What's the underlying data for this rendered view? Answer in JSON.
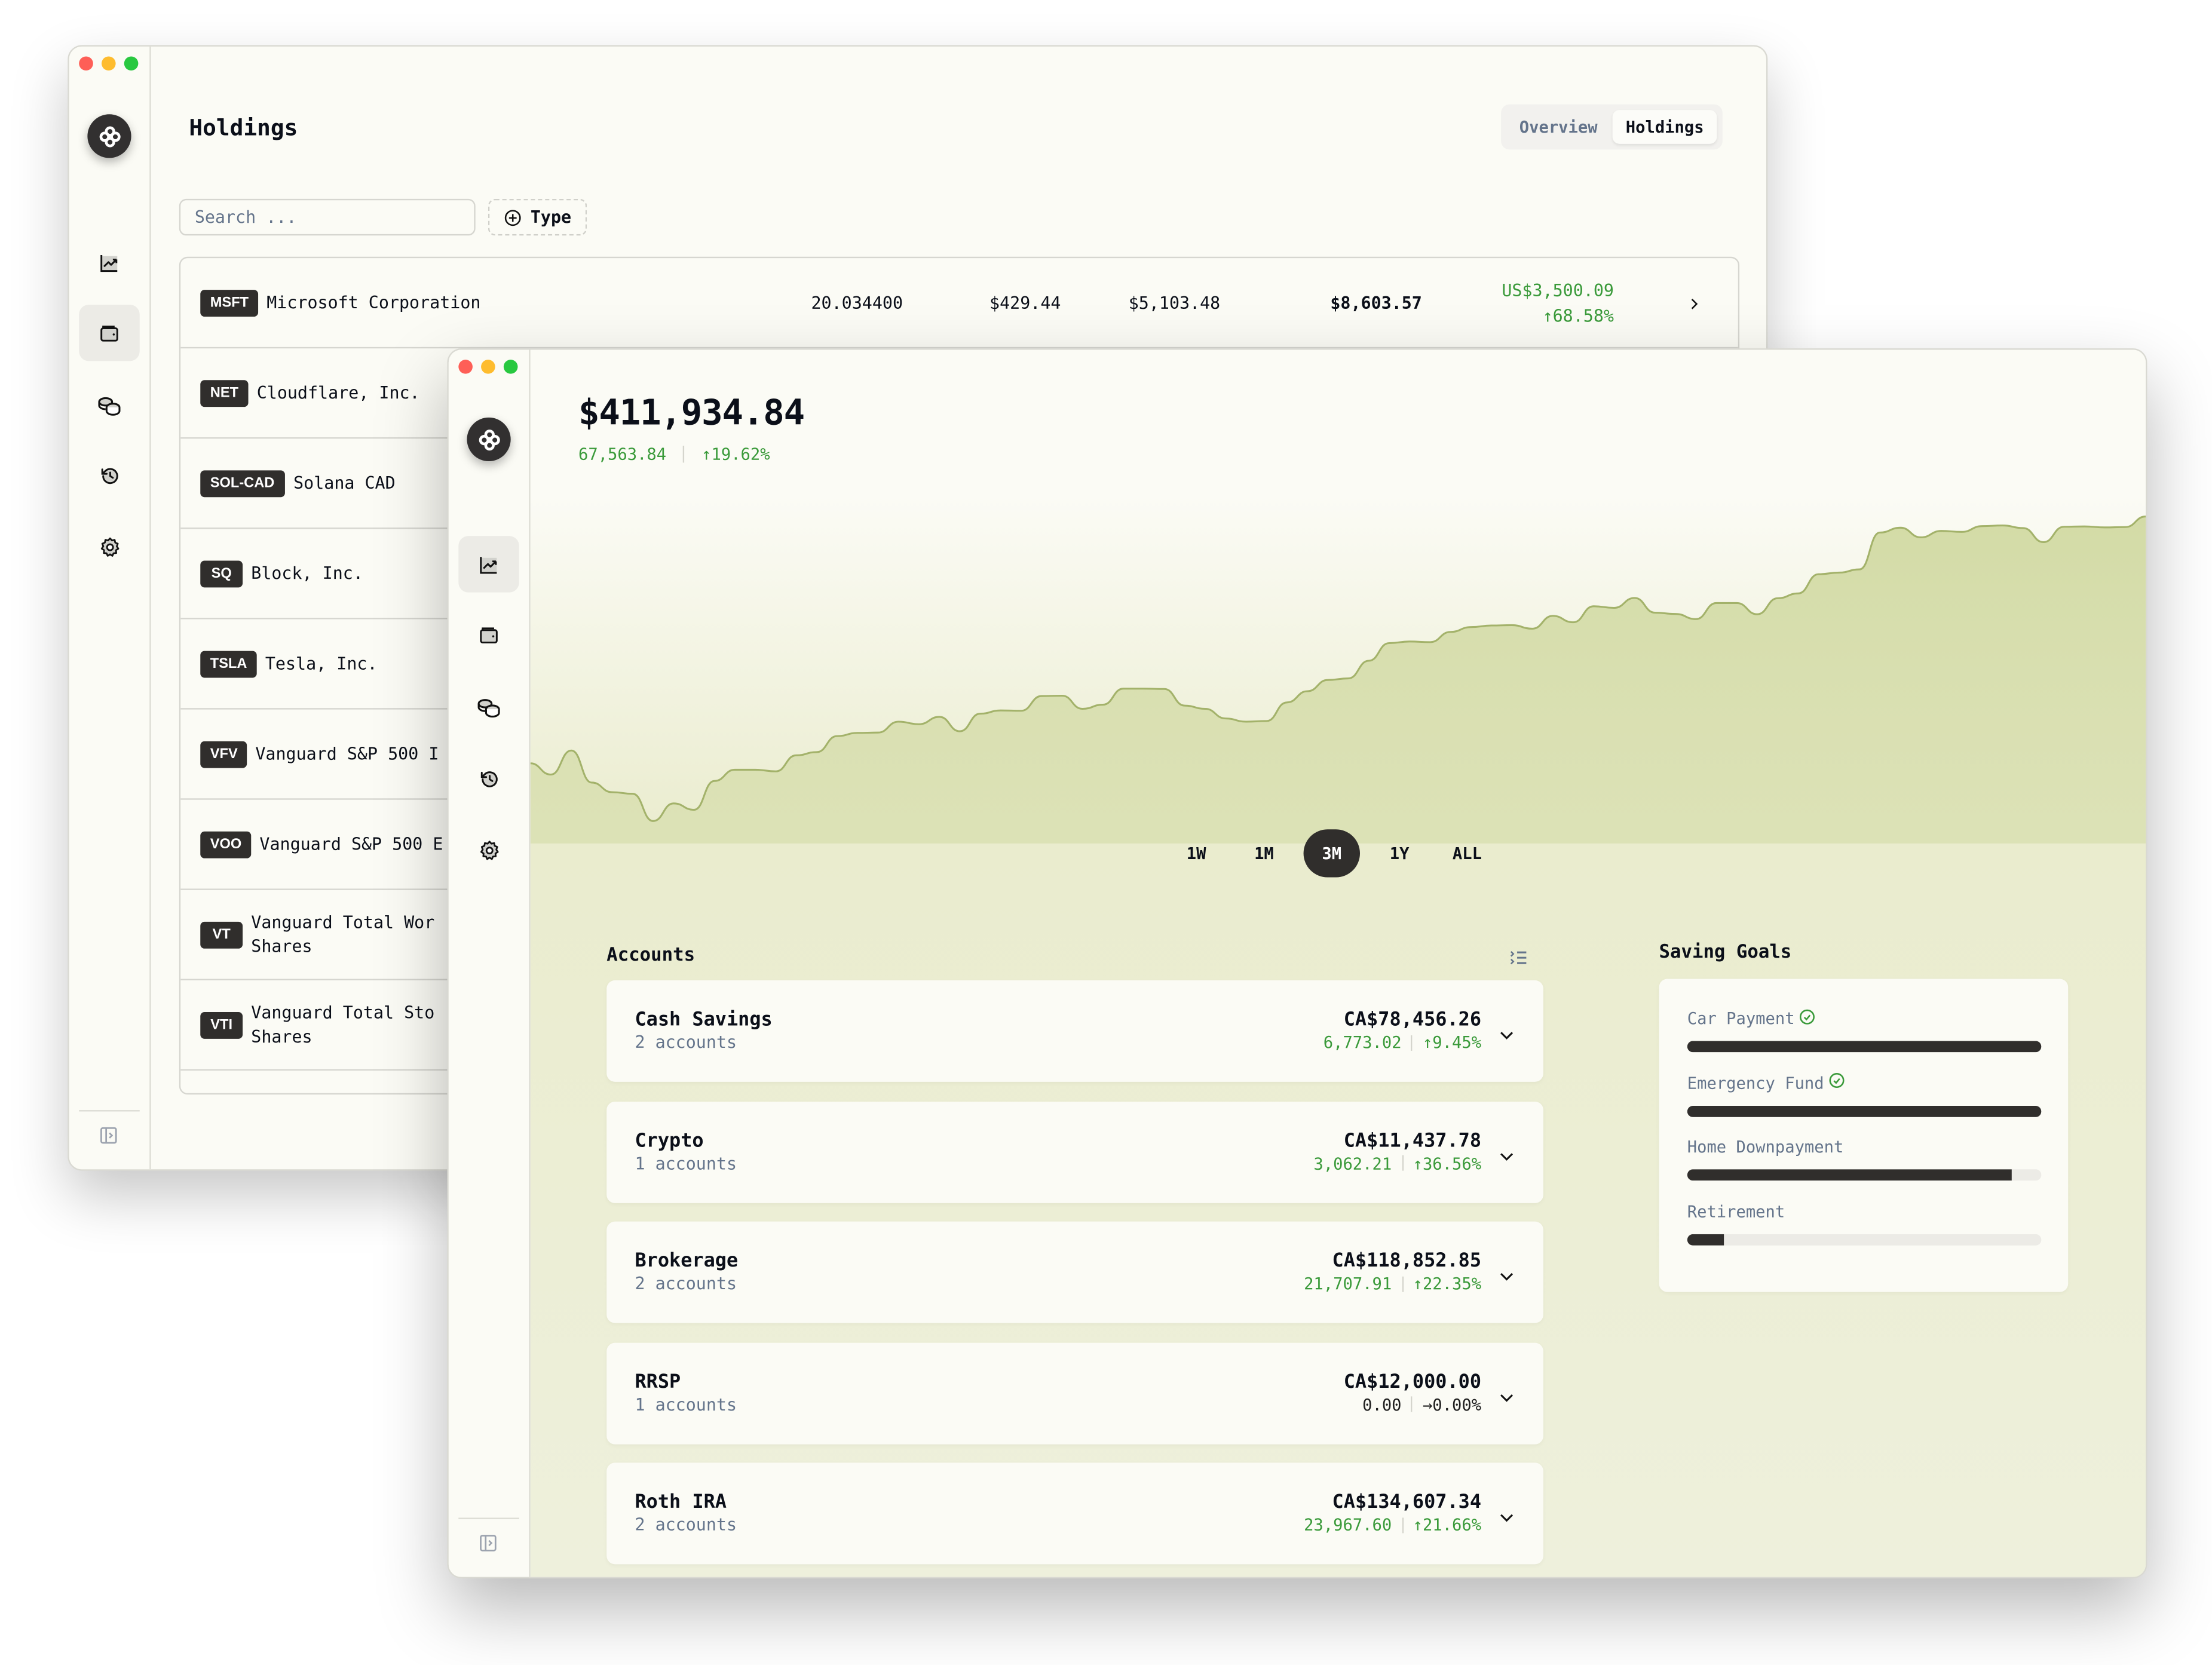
{
  "window_controls": {
    "close": "close",
    "minimize": "minimize",
    "maximize": "maximize"
  },
  "sidebar": {
    "logo": "app-logo",
    "items": [
      {
        "id": "performance",
        "icon": "chart-line-icon"
      },
      {
        "id": "holdings",
        "icon": "wallet-icon"
      },
      {
        "id": "income",
        "icon": "coins-icon"
      },
      {
        "id": "activity",
        "icon": "history-icon"
      },
      {
        "id": "settings",
        "icon": "gear-icon"
      }
    ],
    "collapse_icon": "sidebar-expand-icon"
  },
  "holdings_window": {
    "title": "Holdings",
    "tabs": [
      {
        "label": "Overview",
        "active": false
      },
      {
        "label": "Holdings",
        "active": true
      }
    ],
    "search": {
      "placeholder": "Search ...",
      "value": ""
    },
    "type_filter_label": "Type",
    "rows": [
      {
        "ticker": "MSFT",
        "name": "Microsoft Corporation",
        "quantity": "20.034400",
        "price": "$429.44",
        "book_value": "$5,103.48",
        "market_value": "$8,603.57",
        "gain": "US$3,500.09",
        "gain_pct": "↑68.58%"
      },
      {
        "ticker": "NET",
        "name": "Cloudflare, Inc."
      },
      {
        "ticker": "SOL-CAD",
        "name": "Solana CAD"
      },
      {
        "ticker": "SQ",
        "name": "Block, Inc."
      },
      {
        "ticker": "TSLA",
        "name": "Tesla, Inc."
      },
      {
        "ticker": "VFV",
        "name": "Vanguard S&P 500 I"
      },
      {
        "ticker": "VOO",
        "name": "Vanguard S&P 500 E"
      },
      {
        "ticker": "VT",
        "name": "Vanguard Total Wor\nShares"
      },
      {
        "ticker": "VTI",
        "name": "Vanguard Total Sto\nShares"
      }
    ]
  },
  "dashboard_window": {
    "total_value": "$411,934.84",
    "total_gain": "67,563.84",
    "total_gain_pct": "↑19.62%",
    "ranges": [
      {
        "label": "1W",
        "active": false
      },
      {
        "label": "1M",
        "active": false
      },
      {
        "label": "3M",
        "active": true
      },
      {
        "label": "1Y",
        "active": false
      },
      {
        "label": "ALL",
        "active": false
      }
    ],
    "accounts_title": "Accounts",
    "accounts": [
      {
        "name": "Cash Savings",
        "count": "2 accounts",
        "value": "CA$78,456.26",
        "gain": "6,773.02",
        "gain_pct": "↑9.45%",
        "trend": "up"
      },
      {
        "name": "Crypto",
        "count": "1 accounts",
        "value": "CA$11,437.78",
        "gain": "3,062.21",
        "gain_pct": "↑36.56%",
        "trend": "up"
      },
      {
        "name": "Brokerage",
        "count": "2 accounts",
        "value": "CA$118,852.85",
        "gain": "21,707.91",
        "gain_pct": "↑22.35%",
        "trend": "up"
      },
      {
        "name": "RRSP",
        "count": "1 accounts",
        "value": "CA$12,000.00",
        "gain": "0.00",
        "gain_pct": "→0.00%",
        "trend": "flat"
      },
      {
        "name": "Roth IRA",
        "count": "2 accounts",
        "value": "CA$134,607.34",
        "gain": "23,967.60",
        "gain_pct": "↑21.66%",
        "trend": "up"
      }
    ],
    "goals_title": "Saving Goals",
    "goals": [
      {
        "label": "Car Payment",
        "progress": 1.0,
        "completed": true
      },
      {
        "label": "Emergency Fund",
        "progress": 1.0,
        "completed": true
      },
      {
        "label": "Home Downpayment",
        "progress": 0.915,
        "completed": false
      },
      {
        "label": "Retirement",
        "progress": 0.105,
        "completed": false
      }
    ]
  },
  "colors": {
    "positive": "#3a9a3a",
    "chart_line": "#a3b26a",
    "chart_fill_top": "#d3dba6",
    "chart_fill_bottom": "#e8ebcb",
    "dark": "#302e2c"
  },
  "chart_data": {
    "type": "area",
    "title": "",
    "xlabel": "",
    "ylabel": "",
    "range": "3M",
    "grid": false,
    "legend": "none",
    "x": [
      0,
      1,
      2,
      3,
      4,
      5,
      6,
      7,
      8,
      9,
      10,
      11,
      12,
      13,
      14,
      15,
      16,
      17,
      18,
      19,
      20,
      21,
      22,
      23,
      24,
      25,
      26,
      27,
      28,
      29,
      30,
      31,
      32,
      33,
      34,
      35,
      36,
      37,
      38,
      39,
      40,
      41,
      42,
      43,
      44,
      45,
      46,
      47,
      48,
      49,
      50,
      51,
      52,
      53,
      54,
      55,
      56,
      57,
      58,
      59,
      60,
      61,
      62,
      63,
      64,
      65,
      66,
      67,
      68,
      69,
      70,
      71,
      72,
      73,
      74,
      75,
      76,
      77,
      78,
      79
    ],
    "values": [
      340000,
      336500,
      344000,
      334000,
      331000,
      330500,
      322000,
      327500,
      325500,
      334500,
      338000,
      338000,
      337500,
      342500,
      343500,
      348500,
      349500,
      349600,
      353000,
      352200,
      354500,
      350000,
      355500,
      356500,
      356400,
      361000,
      361100,
      357000,
      358300,
      363300,
      363300,
      363200,
      358000,
      357000,
      354000,
      353000,
      353200,
      359000,
      362500,
      366000,
      366500,
      372000,
      377500,
      378000,
      377800,
      381000,
      382500,
      383000,
      383100,
      382000,
      386000,
      384000,
      389000,
      388500,
      391600,
      387000,
      386600,
      385000,
      390000,
      390000,
      386500,
      391500,
      393000,
      399000,
      399500,
      400500,
      412000,
      413500,
      410500,
      412500,
      412200,
      414000,
      414200,
      413400,
      409000,
      413800,
      413900,
      413600,
      413700,
      417000
    ],
    "ylim": [
      315000,
      425000
    ]
  }
}
